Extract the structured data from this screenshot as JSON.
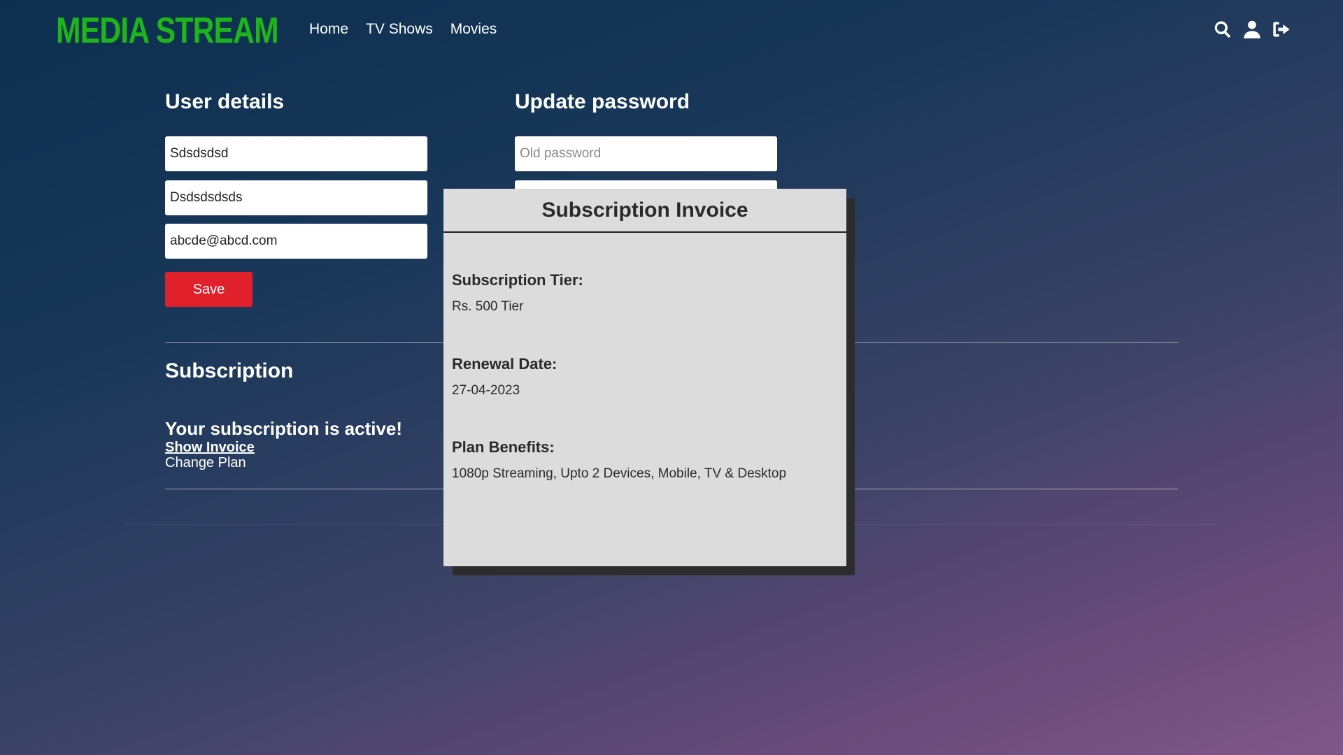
{
  "header": {
    "logo": "MEDIA STREAM",
    "nav": [
      "Home",
      "TV Shows",
      "Movies"
    ],
    "icons": [
      "search-icon",
      "user-icon",
      "logout-icon"
    ]
  },
  "user_details": {
    "title": "User details",
    "first_name": "Sdsdsdsd",
    "last_name": "Dsdsdsdsds",
    "email": "abcde@abcd.com",
    "save_label": "Save"
  },
  "update_password": {
    "title": "Update password",
    "old_password_placeholder": "Old password"
  },
  "subscription": {
    "title": "Subscription",
    "status": "Your subscription is active!",
    "show_invoice": "Show Invoice",
    "change_plan": "Change Plan"
  },
  "invoice": {
    "title": "Subscription Invoice",
    "tier_label": "Subscription Tier:",
    "tier_value": "Rs. 500 Tier",
    "renewal_label": "Renewal Date:",
    "renewal_value": "27-04-2023",
    "benefits_label": "Plan Benefits:",
    "benefits_value": "1080p Streaming, Upto 2 Devices, Mobile, TV & Desktop"
  },
  "colors": {
    "logo": "#1fb31f",
    "save_button": "#e0202b",
    "modal_bg": "#dcdcdc"
  }
}
